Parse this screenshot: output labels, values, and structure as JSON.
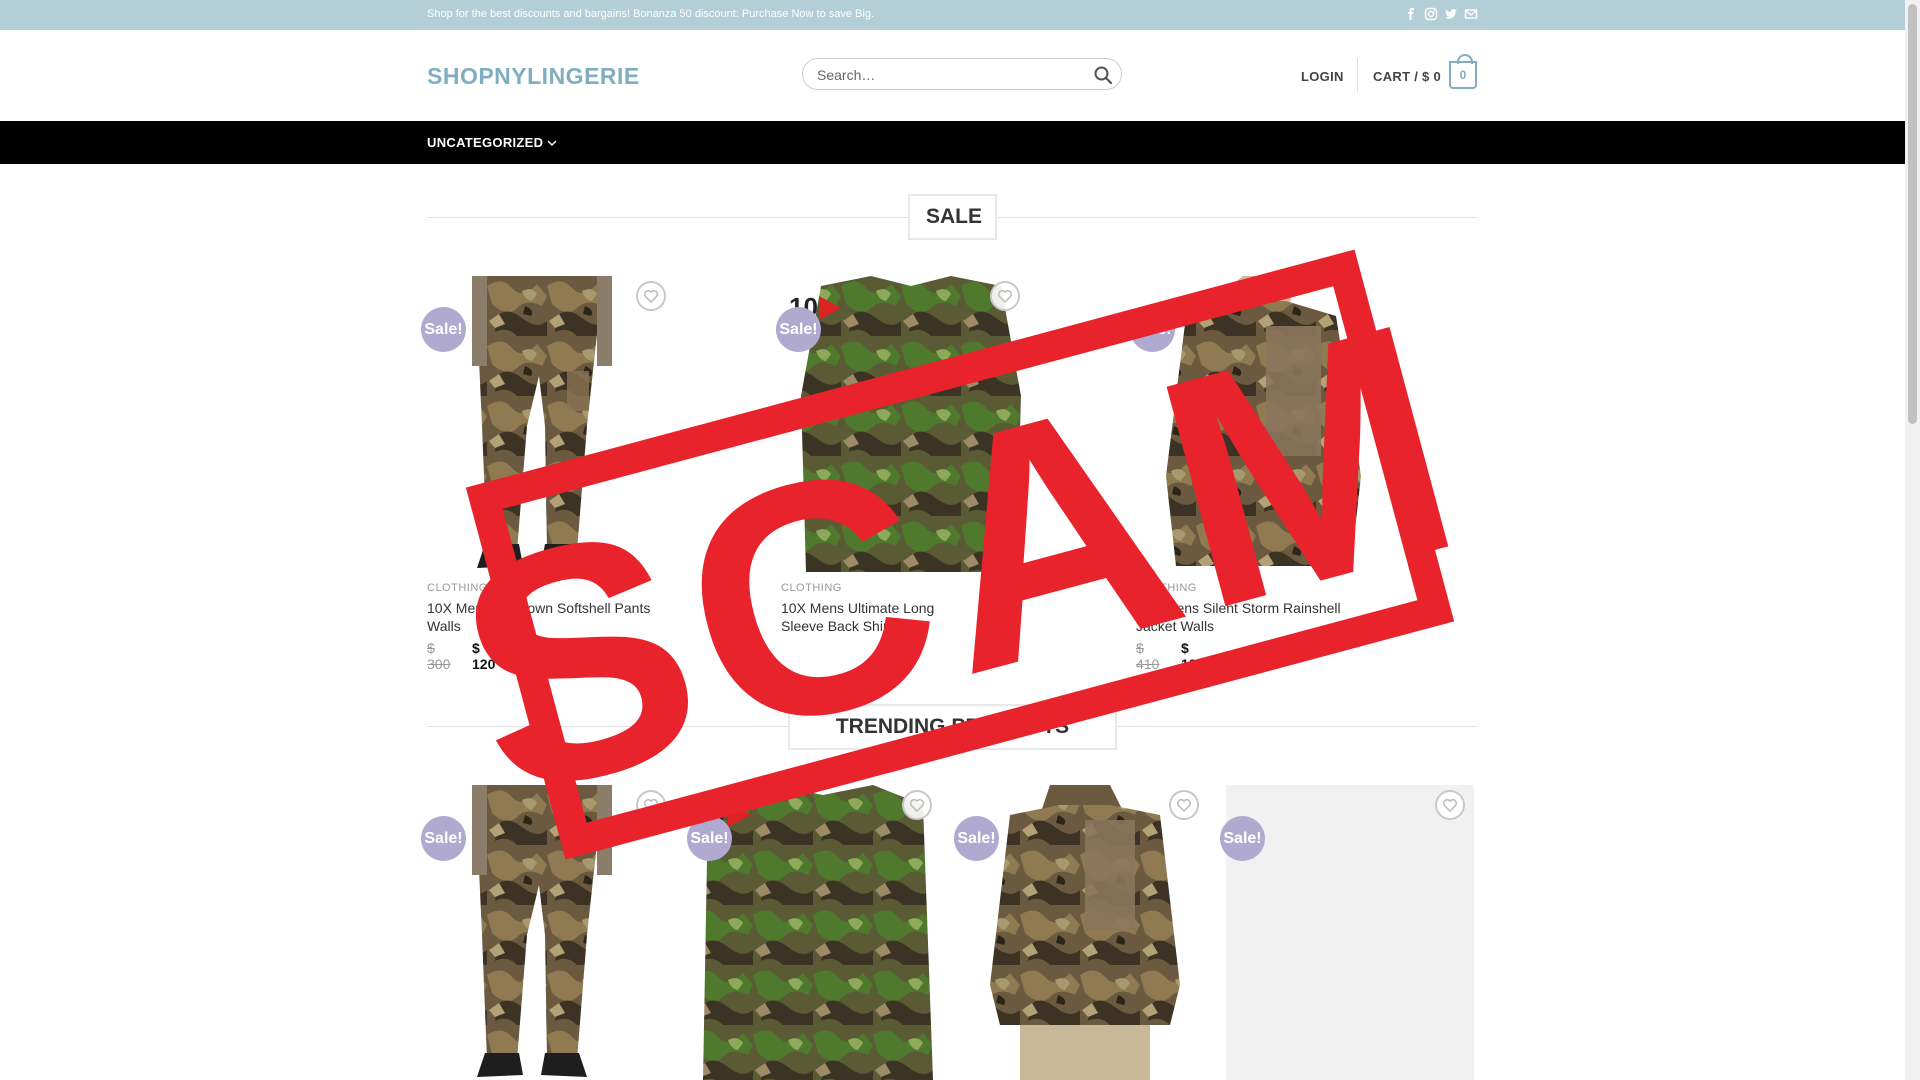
{
  "topbar": {
    "promo": "Shop for the best discounts and bargains! Bonanza 50 discount: Purchase Now to save Big.",
    "social": [
      "facebook-icon",
      "instagram-icon",
      "twitter-icon",
      "envelope-icon"
    ]
  },
  "header": {
    "logo": "SHOPNYLINGERIE",
    "search_placeholder": "Search…",
    "login": "LOGIN",
    "cart_label": "CART / $ 0",
    "cart_count": "0"
  },
  "nav": {
    "item": "UNCATEGORIZED"
  },
  "sections": {
    "sale_title": "SALE",
    "trending_title": "TRENDING PRODUCTS"
  },
  "sale_products": [
    {
      "badge": "Sale!",
      "category": "CLOTHING",
      "name": "10X Mens Lowdown Softshell Pants Walls",
      "price_old": "$ 300",
      "price_new": "$ 120"
    },
    {
      "badge": "Sale!",
      "category": "CLOTHING",
      "name": "10X Mens Ultimate Long Sleeve Back Shirt Walls",
      "price_old": "",
      "price_new": ""
    },
    {
      "badge": "Sale!",
      "category": "CLOTHING",
      "name": "10X Mens Silent Storm Rainshell Jacket Walls",
      "price_old": "$ 410",
      "price_new": "$ 122"
    }
  ],
  "trending_products": [
    {
      "badge": "Sale!"
    },
    {
      "badge": "Sale!"
    },
    {
      "badge": "Sale!"
    },
    {
      "badge": "Sale!"
    }
  ],
  "overlay": {
    "stamp_text": "SCAM"
  },
  "colors": {
    "topbar": "#b4ced7",
    "logo": "#80aec1",
    "sale_badge": "#b1aad0",
    "stamp": "#e9232b"
  }
}
